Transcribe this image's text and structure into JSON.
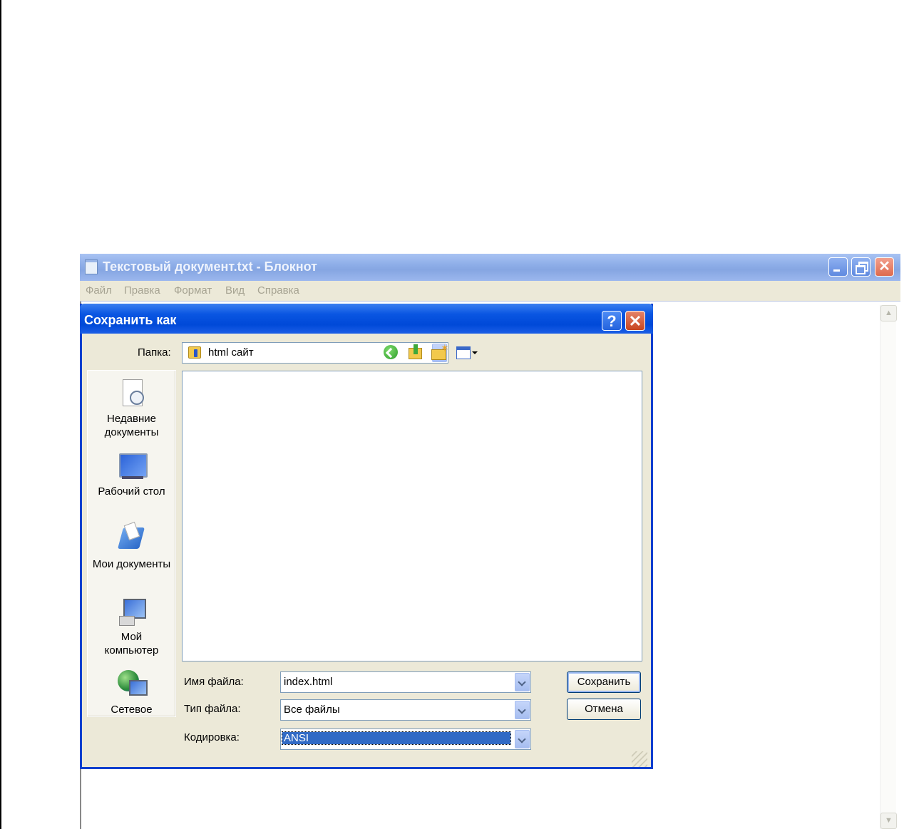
{
  "notepad": {
    "title": "Текстовый документ.txt - Блокнот",
    "menu": [
      "Файл",
      "Правка",
      "Формат",
      "Вид",
      "Справка"
    ]
  },
  "dialog": {
    "title": "Сохранить как",
    "help_label": "?",
    "close_label": "✕",
    "look_in_label": "Папка:",
    "look_in_value": "html сайт",
    "places": [
      {
        "label_line1": "Недавние",
        "label_line2": "документы",
        "icon": "recent-documents-icon"
      },
      {
        "label_line1": "Рабочий стол",
        "label_line2": "",
        "icon": "desktop-icon"
      },
      {
        "label_line1": "Мои документы",
        "label_line2": "",
        "icon": "my-documents-icon"
      },
      {
        "label_line1": "Мой",
        "label_line2": "компьютер",
        "icon": "my-computer-icon"
      },
      {
        "label_line1": "Сетевое",
        "label_line2": "",
        "icon": "network-icon"
      }
    ],
    "filename_label": "Имя файла:",
    "filename_value": "index.html",
    "filetype_label": "Тип файла:",
    "filetype_value": "Все файлы",
    "encoding_label": "Кодировка:",
    "encoding_value": "ANSI",
    "save_button": "Сохранить",
    "cancel_button": "Отмена"
  },
  "colors": {
    "dialog_titlebar": "#0a56e2",
    "inactive_titlebar": "#8eaee8",
    "selection": "#316ac5"
  }
}
